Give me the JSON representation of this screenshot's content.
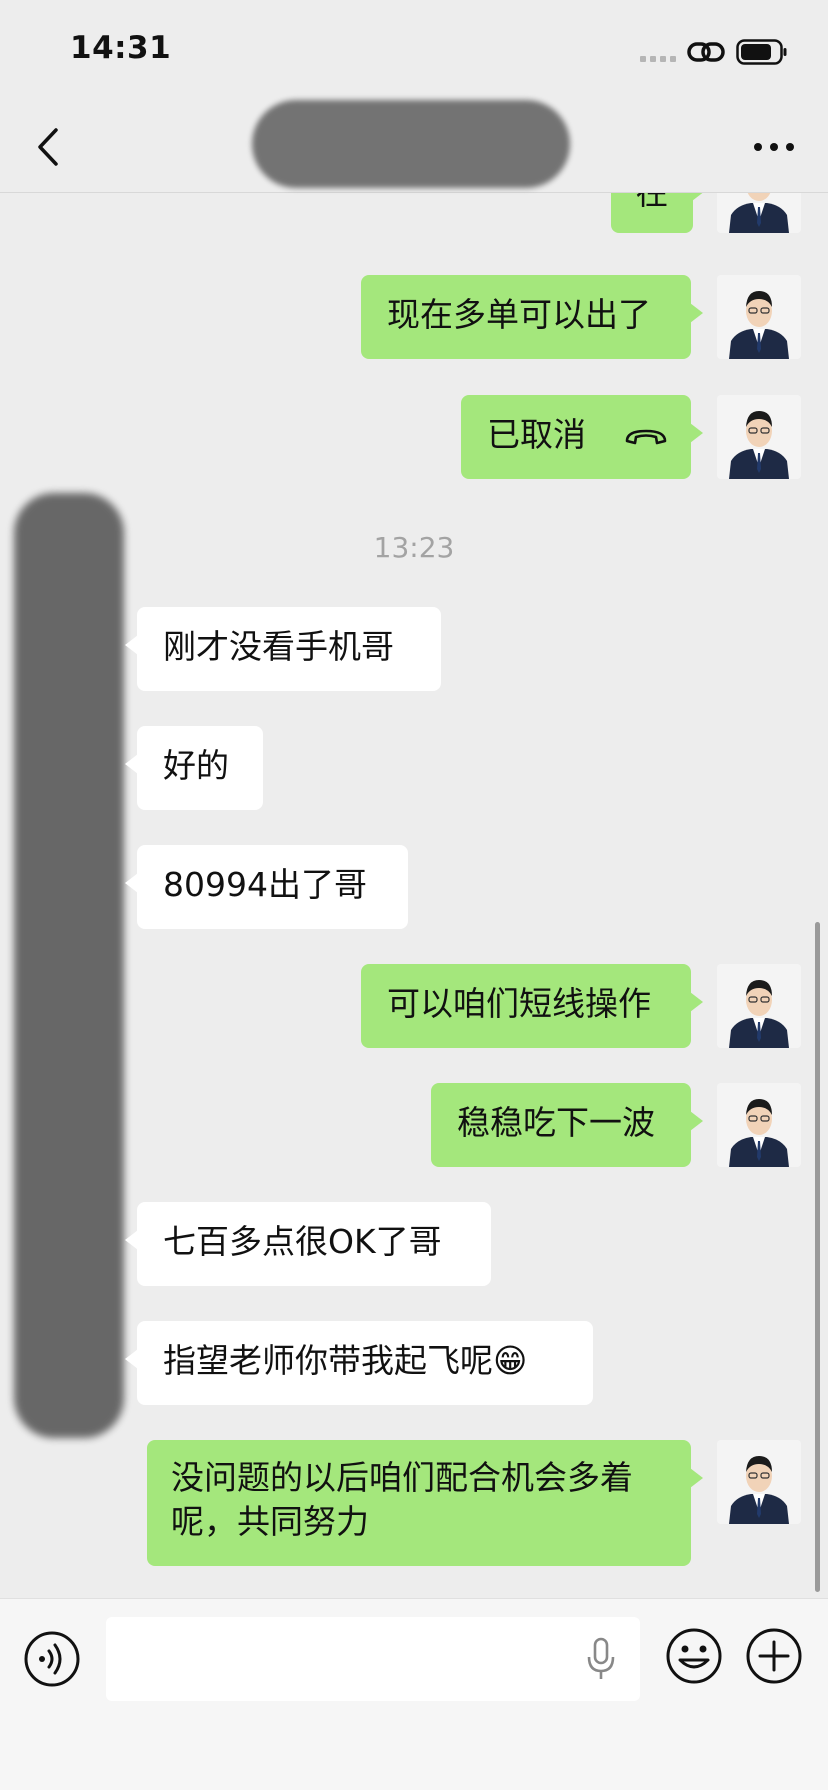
{
  "status_bar": {
    "time": "14:31"
  },
  "nav": {
    "title": "",
    "back_icon": "chevron-left-icon",
    "more_icon": "ellipsis-icon"
  },
  "messages": [
    {
      "side": "out",
      "text": "在"
    },
    {
      "side": "out",
      "text": "现在多单可以出了"
    },
    {
      "side": "out",
      "text": "已取消",
      "icon": "phone-hangup-icon"
    },
    {
      "side": "timestamp",
      "text": "13:23"
    },
    {
      "side": "in",
      "text": "刚才没看手机哥"
    },
    {
      "side": "in",
      "text": "好的"
    },
    {
      "side": "in",
      "text": "80994出了哥"
    },
    {
      "side": "out",
      "text": "可以咱们短线操作"
    },
    {
      "side": "out",
      "text": "稳稳吃下一波"
    },
    {
      "side": "in",
      "text": "七百多点很OK了哥"
    },
    {
      "side": "in",
      "text": "指望老师你带我起飞呢😁"
    },
    {
      "side": "out",
      "text": "没问题的以后咱们配合机会多着呢，共同努力"
    }
  ],
  "input_bar": {
    "voice_icon": "voice-icon",
    "mic_icon": "microphone-icon",
    "emoji_icon": "emoji-icon",
    "plus_icon": "plus-icon",
    "value": ""
  },
  "colors": {
    "outgoing_bubble": "#a4e77c",
    "incoming_bubble": "#ffffff",
    "background": "#ededed"
  }
}
